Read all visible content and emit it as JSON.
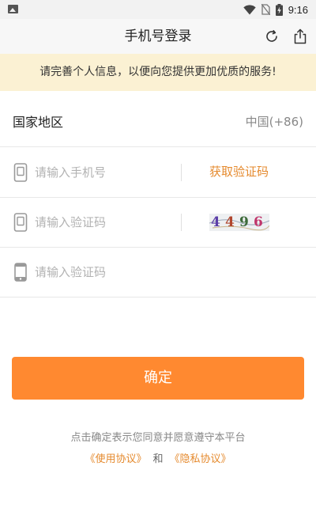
{
  "status_bar": {
    "time": "9:16",
    "icons": [
      "image-icon",
      "wifi-icon",
      "no-sim-icon",
      "battery-charging-icon"
    ]
  },
  "nav": {
    "title": "手机号登录",
    "refresh_icon": "refresh-icon",
    "share_icon": "share-icon"
  },
  "notice": {
    "text": "请完善个人信息，以便向您提供更加优质的服务!"
  },
  "form": {
    "region": {
      "label": "国家地区",
      "value": "中国(+86)"
    },
    "phone": {
      "placeholder": "请输入手机号",
      "value": "",
      "get_code_label": "获取验证码",
      "icon": "phone-icon"
    },
    "captcha": {
      "placeholder": "请输入验证码",
      "value": "",
      "image_text": [
        "4",
        "4",
        "9",
        "6"
      ],
      "icon": "phone-icon"
    },
    "sms_code": {
      "placeholder": "请输入验证码",
      "value": "",
      "icon": "mobile-icon"
    }
  },
  "confirm_button": {
    "label": "确定"
  },
  "agreement": {
    "text": "点击确定表示您同意并愿意遵守本平台",
    "terms_link": "《使用协议》",
    "and": "和",
    "privacy_link": "《隐私协议》"
  },
  "colors": {
    "accent": "#ff8930",
    "link": "#e58a2e",
    "notice_bg": "#fbf1d3"
  }
}
